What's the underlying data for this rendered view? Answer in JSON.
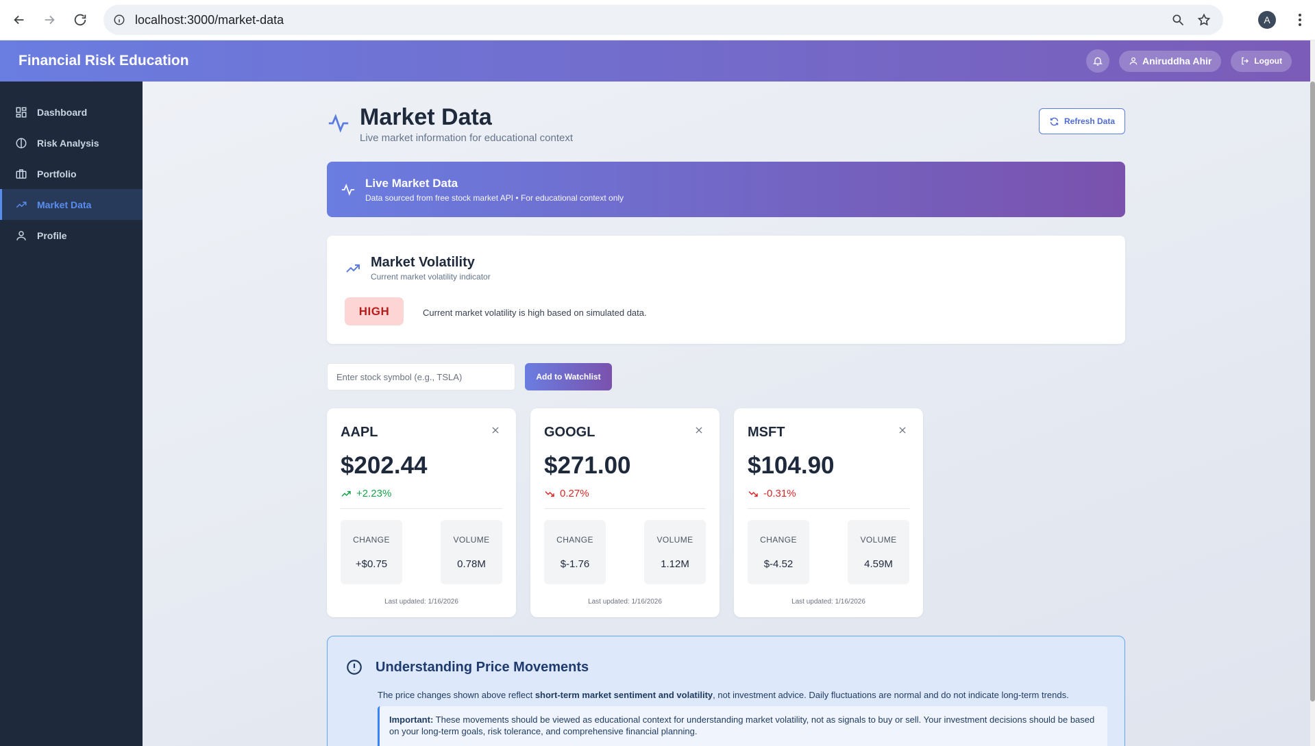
{
  "browser": {
    "url": "localhost:3000/market-data",
    "profile_initial": "A"
  },
  "header": {
    "app_title": "Financial Risk Education",
    "user_name": "Aniruddha Ahir",
    "logout_label": "Logout"
  },
  "sidebar": {
    "items": [
      {
        "label": "Dashboard",
        "icon": "grid-icon",
        "active": false
      },
      {
        "label": "Risk Analysis",
        "icon": "half-circle-icon",
        "active": false
      },
      {
        "label": "Portfolio",
        "icon": "briefcase-icon",
        "active": false
      },
      {
        "label": "Market Data",
        "icon": "trend-up-icon",
        "active": true
      },
      {
        "label": "Profile",
        "icon": "user-icon",
        "active": false
      }
    ]
  },
  "page": {
    "title": "Market Data",
    "subtitle": "Live market information for educational context",
    "refresh_label": "Refresh Data"
  },
  "banner": {
    "title": "Live Market Data",
    "subtitle": "Data sourced from free stock market API • For educational context only"
  },
  "volatility": {
    "title": "Market Volatility",
    "subtitle": "Current market volatility indicator",
    "level": "HIGH",
    "description": "Current market volatility is high based on simulated data."
  },
  "watchlist": {
    "input_placeholder": "Enter stock symbol (e.g., TSLA)",
    "add_label": "Add to Watchlist"
  },
  "stocks": [
    {
      "symbol": "AAPL",
      "price": "$202.44",
      "pct": "+2.23%",
      "direction": "up",
      "change_label": "CHANGE",
      "change": "+$0.75",
      "volume_label": "VOLUME",
      "volume": "0.78M",
      "updated": "Last updated: 1/16/2026"
    },
    {
      "symbol": "GOOGL",
      "price": "$271.00",
      "pct": "0.27%",
      "direction": "down",
      "change_label": "CHANGE",
      "change": "$-1.76",
      "volume_label": "VOLUME",
      "volume": "1.12M",
      "updated": "Last updated: 1/16/2026"
    },
    {
      "symbol": "MSFT",
      "price": "$104.90",
      "pct": "-0.31%",
      "direction": "down",
      "change_label": "CHANGE",
      "change": "$-4.52",
      "volume_label": "VOLUME",
      "volume": "4.59M",
      "updated": "Last updated: 1/16/2026"
    }
  ],
  "info": {
    "title": "Understanding Price Movements",
    "text_pre": "The price changes shown above reflect ",
    "text_bold": "short-term market sentiment and volatility",
    "text_post": ", not investment advice. Daily fluctuations are normal and do not indicate long-term trends.",
    "important_label": "Important:",
    "important_text": " These movements should be viewed as educational context for understanding market volatility, not as signals to buy or sell. Your investment decisions should be based on your long-term goals, risk tolerance, and comprehensive financial planning."
  },
  "colors": {
    "accent": "#5b7be0",
    "header_start": "#6a7de0",
    "header_end": "#7b5cb8",
    "sidebar_bg": "#1e293b",
    "up": "#16a34a",
    "down": "#dc2626",
    "high_badge_bg": "#fdd5d5"
  }
}
